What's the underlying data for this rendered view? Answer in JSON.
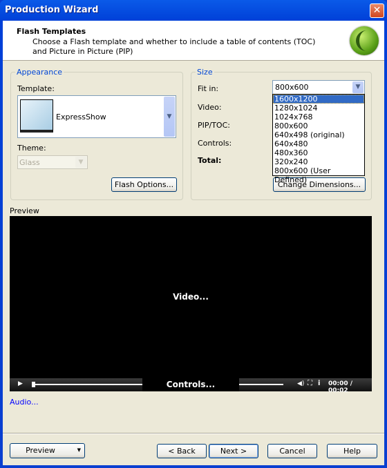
{
  "window": {
    "title": "Production Wizard",
    "close": "✕"
  },
  "header": {
    "title": "Flash Templates",
    "description": "Choose a Flash template and whether to include a table of contents (TOC) and Picture in Picture (PIP)"
  },
  "appearance": {
    "group_label": "Appearance",
    "template_label": "Template:",
    "template_value": "ExpressShow",
    "theme_label": "Theme:",
    "theme_value": "Glass",
    "flash_options": "Flash Options..."
  },
  "size": {
    "group_label": "Size",
    "fit_in_label": "Fit in:",
    "fit_in_value": "800x600",
    "video_label": "Video:",
    "piptoc_label": "PIP/TOC:",
    "controls_label": "Controls:",
    "total_label": "Total:",
    "change_dimensions": "Change Dimensions...",
    "options": [
      "1600x1200",
      "1280x1024",
      "1024x768",
      "800x600",
      "640x498 (original)",
      "640x480",
      "480x360",
      "320x240",
      "800x600 (User Defined)"
    ],
    "highlighted": "1600x1200"
  },
  "preview": {
    "label": "Preview",
    "video_text": "Video...",
    "controls_text": "Controls...",
    "time": "00:00 / 00:02"
  },
  "audio_link": "Audio...",
  "footer": {
    "preview": "Preview",
    "back": "< Back",
    "next": "Next >",
    "cancel": "Cancel",
    "help": "Help"
  }
}
